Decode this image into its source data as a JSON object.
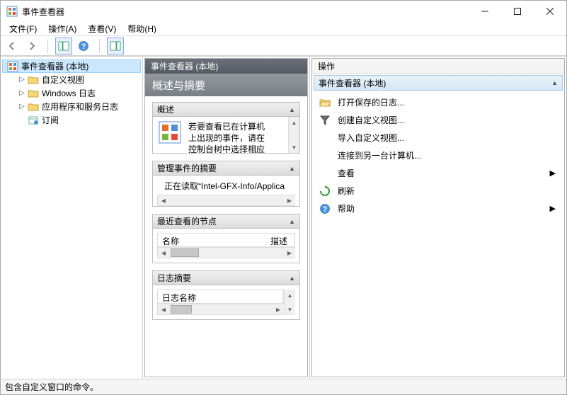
{
  "window": {
    "title": "事件查看器"
  },
  "menus": {
    "file": "文件(F)",
    "action": "操作(A)",
    "view": "查看(V)",
    "help": "帮助(H)"
  },
  "tree": {
    "root": "事件查看器 (本地)",
    "children": [
      {
        "label": "自定义视图"
      },
      {
        "label": "Windows 日志"
      },
      {
        "label": "应用程序和服务日志"
      },
      {
        "label": "订阅"
      }
    ]
  },
  "center": {
    "header": "事件查看器 (本地)",
    "title": "概述与摘要",
    "sections": {
      "overview": {
        "label": "概述",
        "text_line1": "若要查看已在计算机",
        "text_line2": "上出现的事件，请在",
        "text_line3": "控制台树中选择相应"
      },
      "admin": {
        "label": "管理事件的摘要",
        "status": "正在读取“Intel-GFX-Info/Applica"
      },
      "recent": {
        "label": "最近查看的节点",
        "col1": "名称",
        "col2": "描述"
      },
      "logsum": {
        "label": "日志摘要",
        "col1": "日志名称"
      }
    }
  },
  "actions": {
    "title": "操作",
    "group": "事件查看器 (本地)",
    "items": [
      {
        "label": "打开保存的日志...",
        "icon": "folder-open"
      },
      {
        "label": "创建自定义视图...",
        "icon": "filter"
      },
      {
        "label": "导入自定义视图...",
        "icon": "none",
        "indent": true
      },
      {
        "label": "连接到另一台计算机...",
        "icon": "none",
        "indent": true
      },
      {
        "label": "查看",
        "icon": "none",
        "indent": true,
        "submenu": true
      },
      {
        "label": "刷新",
        "icon": "refresh"
      },
      {
        "label": "帮助",
        "icon": "help",
        "submenu": true
      }
    ]
  },
  "statusbar": "包含自定义窗口的命令。"
}
